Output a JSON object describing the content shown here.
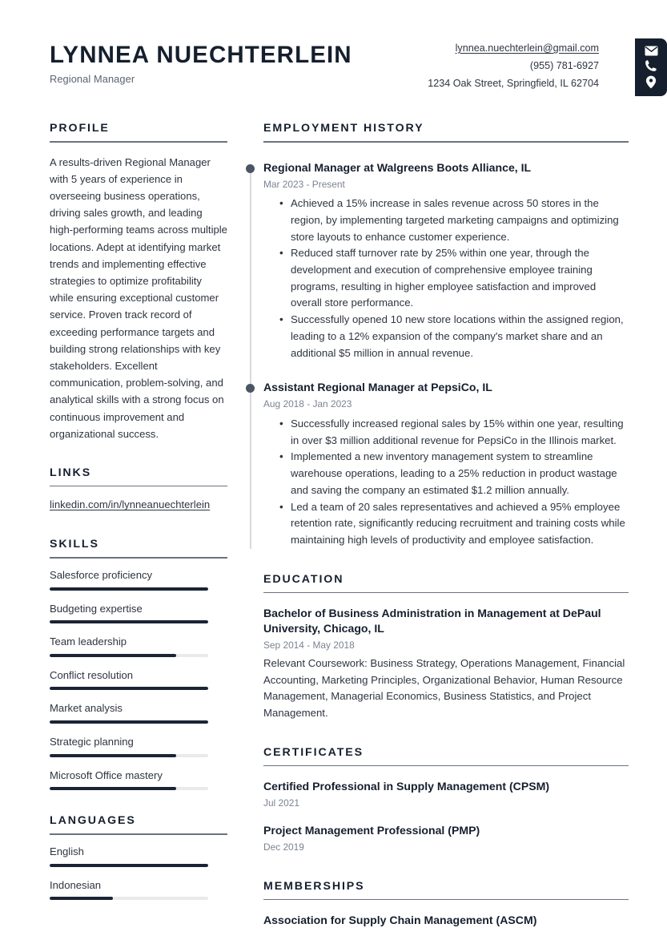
{
  "header": {
    "name": "LYNNEA NUECHTERLEIN",
    "job_title": "Regional Manager",
    "contact": {
      "email": "lynnea.nuechterlein@gmail.com",
      "phone": "(955) 781-6927",
      "address": "1234 Oak Street, Springfield, IL 62704"
    },
    "icons": [
      "envelope-icon",
      "phone-icon",
      "location-pin-icon"
    ]
  },
  "left": {
    "profile": {
      "title": "PROFILE",
      "text": "A results-driven Regional Manager with 5 years of experience in overseeing business operations, driving sales growth, and leading high-performing teams across multiple locations. Adept at identifying market trends and implementing effective strategies to optimize profitability while ensuring exceptional customer service. Proven track record of exceeding performance targets and building strong relationships with key stakeholders. Excellent communication, problem-solving, and analytical skills with a strong focus on continuous improvement and organizational success."
    },
    "links": {
      "title": "LINKS",
      "items": [
        {
          "label": "linkedin.com/in/lynneanuechterlein"
        }
      ]
    },
    "skills": {
      "title": "SKILLS",
      "items": [
        {
          "label": "Salesforce proficiency",
          "level": 100
        },
        {
          "label": "Budgeting expertise",
          "level": 100
        },
        {
          "label": "Team leadership",
          "level": 80
        },
        {
          "label": "Conflict resolution",
          "level": 100
        },
        {
          "label": "Market analysis",
          "level": 100
        },
        {
          "label": "Strategic planning",
          "level": 80
        },
        {
          "label": "Microsoft Office mastery",
          "level": 80
        }
      ]
    },
    "languages": {
      "title": "LANGUAGES",
      "items": [
        {
          "label": "English",
          "level": 100
        },
        {
          "label": "Indonesian",
          "level": 40
        }
      ]
    }
  },
  "right": {
    "employment": {
      "title": "EMPLOYMENT HISTORY",
      "jobs": [
        {
          "title": "Regional Manager at Walgreens Boots Alliance, IL",
          "date": "Mar 2023 - Present",
          "bullets": [
            "Achieved a 15% increase in sales revenue across 50 stores in the region, by implementing targeted marketing campaigns and optimizing store layouts to enhance customer experience.",
            "Reduced staff turnover rate by 25% within one year, through the development and execution of comprehensive employee training programs, resulting in higher employee satisfaction and improved overall store performance.",
            "Successfully opened 10 new store locations within the assigned region, leading to a 12% expansion of the company's market share and an additional $5 million in annual revenue."
          ]
        },
        {
          "title": "Assistant Regional Manager at PepsiCo, IL",
          "date": "Aug 2018 - Jan 2023",
          "bullets": [
            "Successfully increased regional sales by 15% within one year, resulting in over $3 million additional revenue for PepsiCo in the Illinois market.",
            "Implemented a new inventory management system to streamline warehouse operations, leading to a 25% reduction in product wastage and saving the company an estimated $1.2 million annually.",
            "Led a team of 20 sales representatives and achieved a 95% employee retention rate, significantly reducing recruitment and training costs while maintaining high levels of productivity and employee satisfaction."
          ]
        }
      ]
    },
    "education": {
      "title": "EDUCATION",
      "entries": [
        {
          "title": "Bachelor of Business Administration in Management at DePaul University, Chicago, IL",
          "date": "Sep 2014 - May 2018",
          "desc": "Relevant Coursework: Business Strategy, Operations Management, Financial Accounting, Marketing Principles, Organizational Behavior, Human Resource Management, Managerial Economics, Business Statistics, and Project Management."
        }
      ]
    },
    "certificates": {
      "title": "CERTIFICATES",
      "entries": [
        {
          "title": "Certified Professional in Supply Management (CPSM)",
          "date": "Jul 2021"
        },
        {
          "title": "Project Management Professional (PMP)",
          "date": "Dec 2019"
        }
      ]
    },
    "memberships": {
      "title": "MEMBERSHIPS",
      "entries": [
        {
          "title": "Association for Supply Chain Management (ASCM)"
        }
      ]
    }
  },
  "colors": {
    "ink": "#161f2e",
    "body": "#2e3440",
    "muted": "#7b8391",
    "rule": "#6b7280",
    "bar_fill": "#1b2435",
    "bar_track": "#e8eaec",
    "icon_bar_bg": "#161f2e",
    "timeline_line": "#d7dade",
    "timeline_dot": "#4b5563"
  }
}
